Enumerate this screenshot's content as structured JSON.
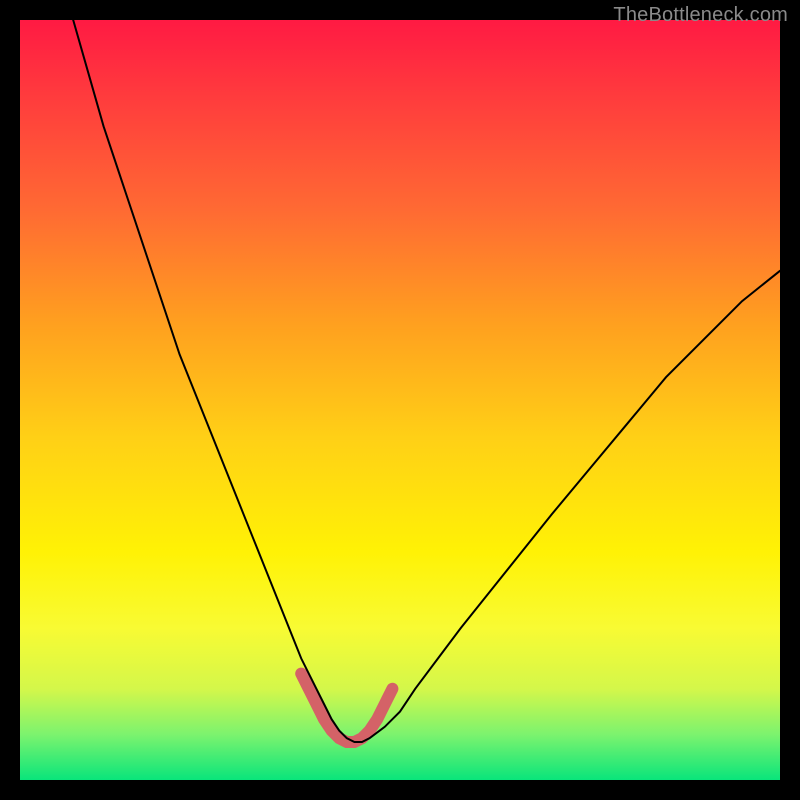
{
  "watermark": "TheBottleneck.com",
  "chart_data": {
    "type": "line",
    "title": "",
    "xlabel": "",
    "ylabel": "",
    "xlim": [
      0,
      100
    ],
    "ylim": [
      0,
      100
    ],
    "grid": false,
    "series": [
      {
        "name": "bottleneck-curve",
        "x": [
          7,
          9,
          11,
          13,
          15,
          17,
          19,
          21,
          23,
          25,
          27,
          29,
          31,
          33,
          35,
          37,
          39,
          40,
          41,
          42,
          43,
          44,
          45,
          46,
          48,
          50,
          52,
          55,
          58,
          62,
          66,
          70,
          75,
          80,
          85,
          90,
          95,
          100
        ],
        "y": [
          100,
          93,
          86,
          80,
          74,
          68,
          62,
          56,
          51,
          46,
          41,
          36,
          31,
          26,
          21,
          16,
          12,
          10,
          8,
          6.5,
          5.5,
          5,
          5,
          5.5,
          7,
          9,
          12,
          16,
          20,
          25,
          30,
          35,
          41,
          47,
          53,
          58,
          63,
          67
        ]
      },
      {
        "name": "optimal-zone-highlight",
        "x": [
          37,
          38,
          39,
          40,
          41,
          42,
          43,
          44,
          45,
          46,
          47,
          48,
          49
        ],
        "y": [
          14,
          12,
          10,
          8,
          6.5,
          5.5,
          5,
          5,
          5.5,
          6.5,
          8,
          10,
          12
        ]
      }
    ],
    "background_gradient": {
      "type": "vertical",
      "stops": [
        {
          "pos": 0,
          "color": "#ff1a43"
        },
        {
          "pos": 25,
          "color": "#ff6a33"
        },
        {
          "pos": 55,
          "color": "#ffd016"
        },
        {
          "pos": 80,
          "color": "#f8fb33"
        },
        {
          "pos": 100,
          "color": "#09e57b"
        }
      ]
    }
  }
}
